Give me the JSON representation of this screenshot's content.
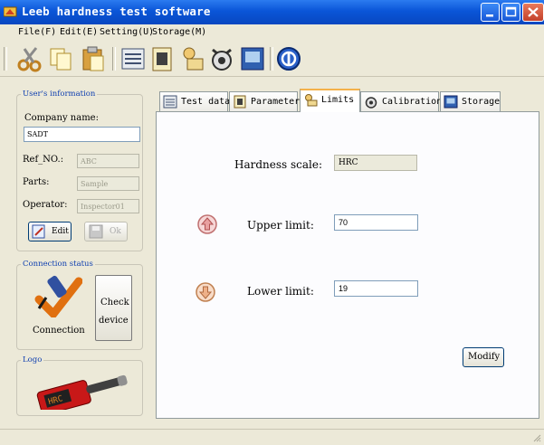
{
  "window": {
    "title": "Leeb hardness test software"
  },
  "menu": [
    "File(F)",
    "Edit(E)",
    "Setting(U)",
    "Storage(M)"
  ],
  "toolbar": {
    "icons": [
      "scissors-icon",
      "copy-icon",
      "paste-icon",
      "test-data-icon",
      "parameter-icon",
      "limits-icon",
      "calibration-icon",
      "storage-icon",
      "about-icon"
    ]
  },
  "user_info": {
    "legend": "User's information",
    "company_label": "Company name:",
    "company_value": "SADT",
    "ref_label": "Ref_NO.:",
    "ref_value": "ABC",
    "parts_label": "Parts:",
    "parts_value": "Sample",
    "operator_label": "Operator:",
    "operator_value": "Inspector01",
    "edit_label": "Edit",
    "ok_label": "Ok"
  },
  "connection": {
    "legend": "Connection status",
    "status_label": "Connection",
    "check_line1": "Check",
    "check_line2": "device"
  },
  "logo": {
    "legend": "Logo",
    "device_readout": "HRC"
  },
  "tabs": [
    "Test data",
    "Parameter",
    "Limits",
    "Calibration",
    "Storage"
  ],
  "limits": {
    "scale_label": "Hardness scale:",
    "scale_value": "HRC",
    "upper_label": "Upper limit:",
    "upper_value": "70",
    "lower_label": "Lower limit:",
    "lower_value": "19",
    "modify_label": "Modify"
  },
  "colors": {
    "titlebar": "#0a55d8",
    "legend_text": "#1040b0",
    "active_tab_accent": "#f4b24a"
  }
}
